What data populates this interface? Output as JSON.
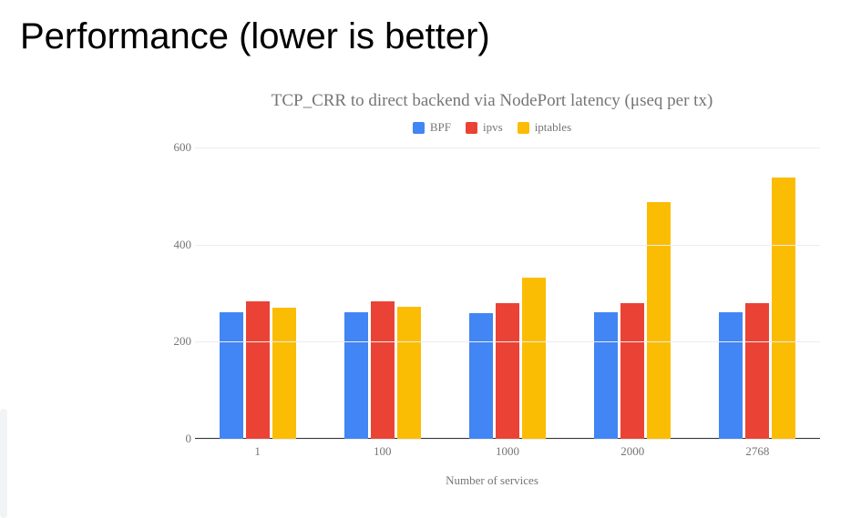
{
  "page": {
    "title": "Performance (lower is better)"
  },
  "chart_data": {
    "type": "bar",
    "title": "TCP_CRR to direct backend via NodePort latency (μseq per tx)",
    "xlabel": "Number of services",
    "ylabel": "",
    "ylim": [
      0,
      600
    ],
    "yticks": [
      0,
      200,
      400,
      600
    ],
    "categories": [
      "1",
      "100",
      "1000",
      "2000",
      "2768"
    ],
    "series": [
      {
        "name": "BPF",
        "color": "#4285f4",
        "values": [
          260,
          260,
          258,
          260,
          260
        ]
      },
      {
        "name": "ipvs",
        "color": "#ea4335",
        "values": [
          283,
          283,
          280,
          280,
          280
        ]
      },
      {
        "name": "iptables",
        "color": "#fbbc04",
        "values": [
          270,
          272,
          332,
          488,
          538
        ]
      }
    ]
  }
}
